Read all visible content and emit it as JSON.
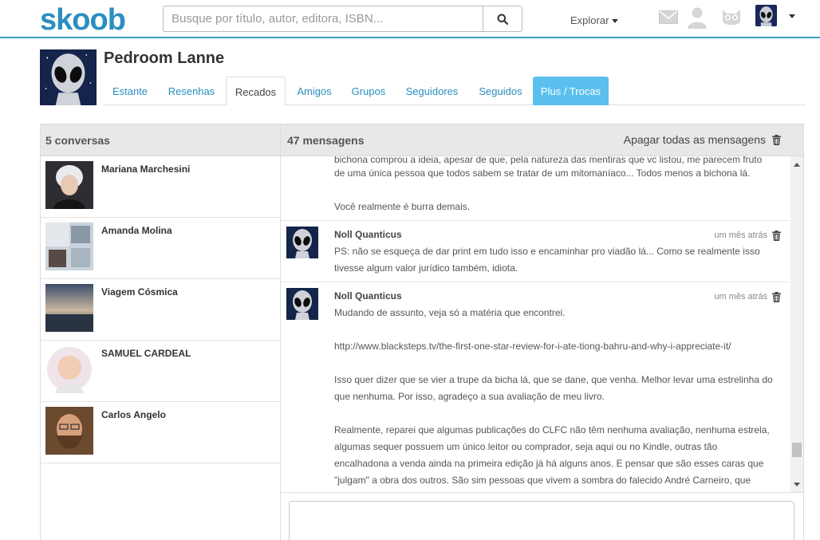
{
  "header": {
    "logo": "skoob",
    "search_placeholder": "Busque por título, autor, editora, ISBN...",
    "explore_label": "Explorar"
  },
  "profile": {
    "name": "Pedroom Lanne",
    "tabs": [
      "Estante",
      "Resenhas",
      "Recados",
      "Amigos",
      "Grupos",
      "Seguidores",
      "Seguidos",
      "Plus / Trocas"
    ],
    "active_tab": "Recados"
  },
  "panel": {
    "conversations_label": "5 conversas",
    "messages_label": "47 mensagens",
    "clear_all_label": "Apagar todas as mensagens"
  },
  "conversations": [
    {
      "name": "Mariana Marchesini"
    },
    {
      "name": "Amanda Molina"
    },
    {
      "name": "Viagem Cósmica"
    },
    {
      "name": "SAMUEL CARDEAL"
    },
    {
      "name": "Carlos Angelo"
    }
  ],
  "thread": {
    "partial_lines": [
      "bichona comprou a ideia, apesar de que, pela natureza das mentiras que vc listou, me parecem fruto",
      "de uma única pessoa que todos sabem se tratar de um mitomaníaco... Todos menos a bichona lá.",
      "",
      "Você realmente é burra demais."
    ],
    "messages": [
      {
        "author": "Noll Quanticus",
        "time": "um mês atrás",
        "lines": [
          "PS: não se esqueça de dar print em tudo isso e encaminhar pro viadão lá... Como se realmente isso",
          "tivesse algum valor jurídico também, idiota."
        ]
      },
      {
        "author": "Noll Quanticus",
        "time": "um mês atrás",
        "lines": [
          "Mudando de assunto, veja só a matéria que encontrei.",
          "",
          "http://www.blacksteps.tv/the-first-one-star-review-for-i-ate-tiong-bahru-and-why-i-appreciate-it/",
          "",
          "Isso quer dizer que se vier a trupe da bicha lá, que se dane, que venha. Melhor levar uma estrelinha do",
          "que nenhuma. Por isso, agradeço a sua avaliação de meu livro.",
          "",
          "Realmente, reparei que algumas publicações do CLFC não têm nenhuma avaliação, nenhuma estrela,",
          "algumas sequer possuem um único leitor ou comprador, seja aqui ou no Kindle, outras tão",
          "encalhadona a venda ainda na primeira edição já há alguns anos. E pensar que são esses caras que",
          "\"julgam\" a obra dos outros. São sim pessoas que vivem a sombra do falecido André Carneiro, que"
        ]
      }
    ]
  }
}
